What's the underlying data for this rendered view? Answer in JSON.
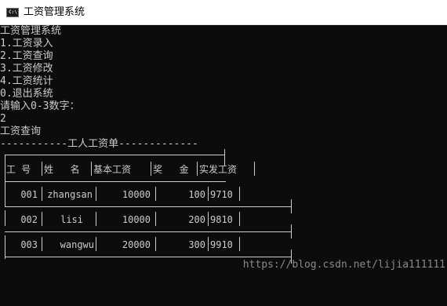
{
  "window": {
    "title": "工资管理系统",
    "icon_name": "console-app-icon",
    "icon_text": "C:\\"
  },
  "console": {
    "lines": [
      "工资管理系统",
      "1.工资录入",
      "2.工资查询",
      "3.工资修改",
      "4.工资统计",
      "0.退出系统",
      "请输入0-3数字：",
      "2",
      "工资查询"
    ],
    "table_title": "工人工资单",
    "table_title_line": "-----------工人工资单-------------",
    "table": {
      "headers": [
        "工 号",
        "姓   名",
        "基本工资",
        "奖   金",
        "实发工资"
      ],
      "rows": [
        [
          "001",
          "zhangsan",
          "10000",
          "100",
          "9710"
        ],
        [
          "002",
          "lisi",
          "10000",
          "200",
          "9810"
        ],
        [
          "003",
          "wangwu",
          "20000",
          "300",
          "9910"
        ]
      ]
    },
    "watermark": "https://blog.csdn.net/lijia111111"
  },
  "colors": {
    "console_bg": "#0c0c0c",
    "console_text": "#cccccc",
    "titlebar_bg": "#ffffff",
    "watermark": "#8a8a8a"
  }
}
